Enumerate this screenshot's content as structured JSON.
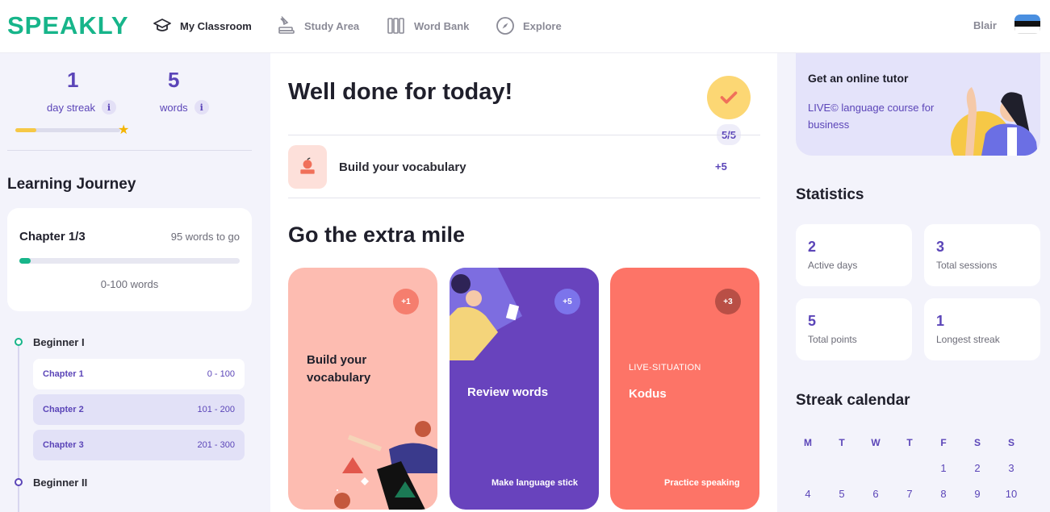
{
  "app": {
    "logo": "SPEAKLY"
  },
  "nav": {
    "my_classroom": "My Classroom",
    "study_area": "Study Area",
    "word_bank": "Word Bank",
    "explore": "Explore"
  },
  "user": {
    "name": "Blair"
  },
  "stats_top": {
    "streak_value": "1",
    "streak_label": "day streak",
    "words_value": "5",
    "words_label": "words",
    "info_glyph": "i",
    "streak_progress": 0.2
  },
  "journey": {
    "title": "Learning Journey",
    "chapter_title": "Chapter 1/3",
    "words_to_go": "95 words to go",
    "range": "0-100 words",
    "progress": 0.05,
    "levels": [
      {
        "name": "Beginner I",
        "color": "#17b58a"
      },
      {
        "name": "Beginner II",
        "color": "#5b45b8"
      }
    ],
    "chapters": [
      {
        "name": "Chapter 1",
        "range": "0 - 100"
      },
      {
        "name": "Chapter 2",
        "range": "101 - 200"
      },
      {
        "name": "Chapter 3",
        "range": "201 - 300"
      }
    ]
  },
  "today": {
    "title": "Well done for today!",
    "score": "5/5",
    "task_label": "Build your vocabulary",
    "task_points": "+5"
  },
  "extra": {
    "title": "Go the extra mile",
    "cards": [
      {
        "title": "Build your vocabulary",
        "points": "+1",
        "bg": "#fdbcb1"
      },
      {
        "title": "Review words",
        "points": "+5",
        "subtitle": "Make language stick",
        "bg": "#6843bd"
      },
      {
        "kicker": "LIVE-SITUATION",
        "title": "Kodus",
        "points": "+3",
        "subtitle": "Practice speaking",
        "bg": "#fd7467"
      }
    ]
  },
  "tutor": {
    "title": "Get an online tutor",
    "desc": "LIVE© language course for business"
  },
  "statistics": {
    "title": "Statistics",
    "items": [
      {
        "value": "2",
        "label": "Active days"
      },
      {
        "value": "3",
        "label": "Total sessions"
      },
      {
        "value": "5",
        "label": "Total points"
      },
      {
        "value": "1",
        "label": "Longest streak"
      }
    ]
  },
  "calendar": {
    "title": "Streak calendar",
    "weekdays": [
      "M",
      "T",
      "W",
      "T",
      "F",
      "S",
      "S"
    ],
    "row1": [
      "1",
      "2",
      "3"
    ],
    "row2": [
      "4",
      "5",
      "6",
      "7",
      "8",
      "9",
      "10"
    ]
  },
  "colors": {
    "brand": "#17b58a",
    "accent": "#5b45b8",
    "yellow": "#f6c846"
  }
}
